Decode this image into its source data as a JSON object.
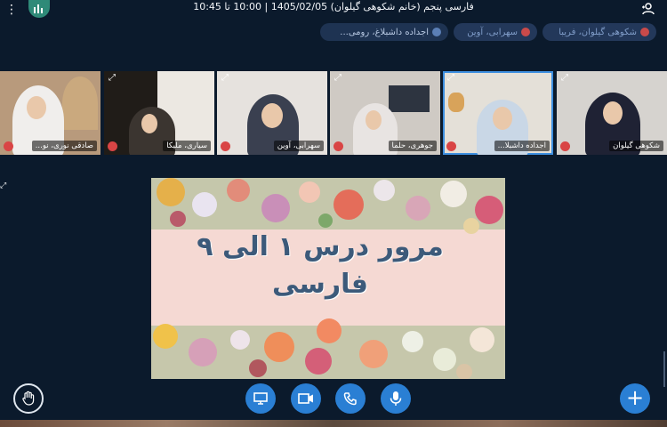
{
  "window": {
    "title": "فارسی پنجم (خانم شکوهی گیلوان) 1405/02/05 | 10:00 تا 10:45"
  },
  "chips": [
    {
      "label": "شکوهی گیلوان، فریبا"
    },
    {
      "label": "سهرابی، آوین"
    },
    {
      "label": "اجداده داشبلاغ، رومی..."
    }
  ],
  "participants": [
    {
      "name": "شکوهی گیلوان"
    },
    {
      "name": "اجداده داشبلا..."
    },
    {
      "name": "جوهری، حلما"
    },
    {
      "name": "سهرابی، آوین"
    },
    {
      "name": "سیاری، ملیکا"
    },
    {
      "name": "صادقی نوری، نو..."
    }
  ],
  "slide": {
    "line1": "مرور درس ۱ الی ۹",
    "line2": "فارسی"
  },
  "controls": [
    {
      "icon": "screen-share-icon"
    },
    {
      "icon": "camera-icon"
    },
    {
      "icon": "phone-icon"
    },
    {
      "icon": "microphone-icon"
    }
  ],
  "colors": {
    "background": "#0b1a2c",
    "accent": "#2a7fd4",
    "mute": "#d94545",
    "chip": "#23385a"
  }
}
